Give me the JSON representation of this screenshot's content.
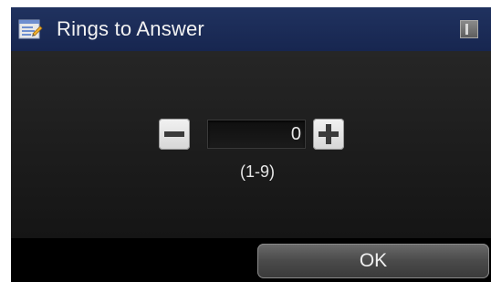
{
  "header": {
    "title": "Rings to Answer",
    "icon": "settings-page-icon",
    "status_icon": "status-indicator-icon"
  },
  "stepper": {
    "value": "0",
    "range": "(1-9)",
    "minus_icon": "minus-icon",
    "plus_icon": "plus-icon"
  },
  "footer": {
    "ok_label": "OK"
  },
  "colors": {
    "title_bar": "#1c2c59",
    "background": "#1f1f1f",
    "text": "#f2f2f2"
  }
}
